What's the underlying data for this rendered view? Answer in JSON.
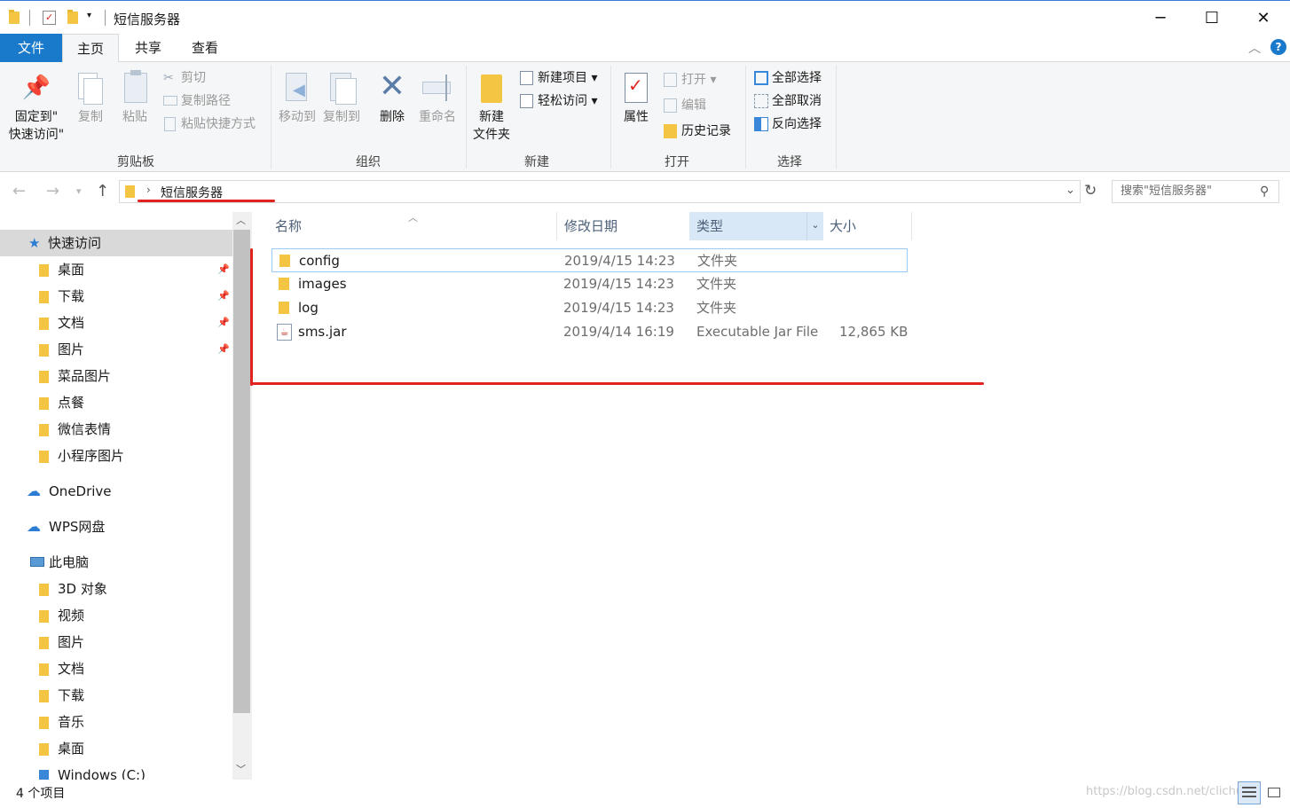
{
  "window": {
    "title": "短信服务器",
    "controls": {
      "minimize": "─",
      "maximize": "☐",
      "close": "✕"
    }
  },
  "menu_tabs": [
    "文件",
    "主页",
    "共享",
    "查看"
  ],
  "ribbon": {
    "clipboard": {
      "pin_label_1": "固定到\"",
      "pin_label_2": "快速访问\"",
      "copy": "复制",
      "paste": "粘贴",
      "cut": "剪切",
      "copy_path": "复制路径",
      "paste_shortcut": "粘贴快捷方式",
      "group": "剪贴板"
    },
    "organize": {
      "move_to": "移动到",
      "copy_to": "复制到",
      "delete": "删除",
      "rename": "重命名",
      "group": "组织"
    },
    "new": {
      "new_folder_1": "新建",
      "new_folder_2": "文件夹",
      "new_item": "新建项目 ▾",
      "easy_access": "轻松访问 ▾",
      "group": "新建"
    },
    "open": {
      "properties": "属性",
      "open": "打开 ▾",
      "edit": "编辑",
      "history": "历史记录",
      "group": "打开"
    },
    "select": {
      "select_all": "全部选择",
      "select_none": "全部取消",
      "invert": "反向选择",
      "group": "选择"
    }
  },
  "address": {
    "path": "短信服务器",
    "search_placeholder": "搜索\"短信服务器\""
  },
  "nav": {
    "quick_access": "快速访问",
    "quick_items": [
      {
        "label": "桌面",
        "pinned": true
      },
      {
        "label": "下载",
        "pinned": true
      },
      {
        "label": "文档",
        "pinned": true
      },
      {
        "label": "图片",
        "pinned": true
      },
      {
        "label": "菜品图片",
        "pinned": false
      },
      {
        "label": "点餐",
        "pinned": false
      },
      {
        "label": "微信表情",
        "pinned": false
      },
      {
        "label": "小程序图片",
        "pinned": false
      }
    ],
    "onedrive": "OneDrive",
    "wps": "WPS网盘",
    "this_pc": "此电脑",
    "pc_items": [
      "3D 对象",
      "视频",
      "图片",
      "文档",
      "下载",
      "音乐",
      "桌面",
      "Windows (C:)"
    ]
  },
  "columns": {
    "name": "名称",
    "date": "修改日期",
    "type": "类型",
    "size": "大小"
  },
  "files": [
    {
      "name": "config",
      "date": "2019/4/15 14:23",
      "type": "文件夹",
      "size": "",
      "icon": "folder-icon"
    },
    {
      "name": "images",
      "date": "2019/4/15 14:23",
      "type": "文件夹",
      "size": "",
      "icon": "folder-icon"
    },
    {
      "name": "log",
      "date": "2019/4/15 14:23",
      "type": "文件夹",
      "size": "",
      "icon": "folder-icon"
    },
    {
      "name": "sms.jar",
      "date": "2019/4/14 16:19",
      "type": "Executable Jar File",
      "size": "12,865 KB",
      "icon": "jar-file-icon"
    }
  ],
  "status": {
    "count": "4 个项目",
    "watermark": "https://blog.csdn.net/clichu"
  },
  "colors": {
    "accent": "#1979ca",
    "folder": "#f4c542",
    "annotation": "#e0231f"
  }
}
